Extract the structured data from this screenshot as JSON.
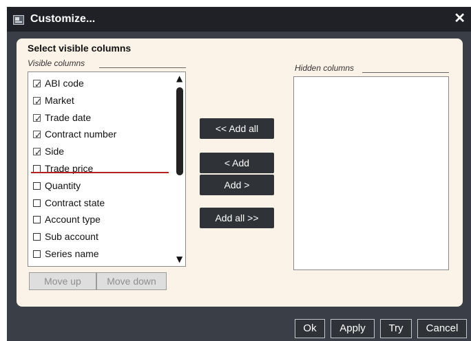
{
  "window": {
    "title": "Customize..."
  },
  "panel": {
    "heading": "Select visible columns",
    "visible_label": "Visible columns",
    "hidden_label": "Hidden columns",
    "visible_items": [
      {
        "label": "ABI code",
        "checked": true
      },
      {
        "label": "Market",
        "checked": true
      },
      {
        "label": "Trade date",
        "checked": true
      },
      {
        "label": "Contract number",
        "checked": true
      },
      {
        "label": "Side",
        "checked": true
      },
      {
        "label": "Trade price",
        "checked": false
      },
      {
        "label": "Quantity",
        "checked": false
      },
      {
        "label": "Contract state",
        "checked": false
      },
      {
        "label": "Account type",
        "checked": false
      },
      {
        "label": "Sub account",
        "checked": false
      },
      {
        "label": "Series name",
        "checked": false
      }
    ],
    "hidden_items": [],
    "move_up": "Move up",
    "move_down": "Move down"
  },
  "transfer": {
    "add_all_left": "<< Add all",
    "add_left": "< Add",
    "add_right": "Add >",
    "add_all_right": "Add all >>"
  },
  "footer": {
    "ok": "Ok",
    "apply": "Apply",
    "try": "Try",
    "cancel": "Cancel"
  },
  "colors": {
    "separator": "#b22222",
    "panel_bg": "#fbf2e8",
    "button_dark": "#2f3237"
  }
}
